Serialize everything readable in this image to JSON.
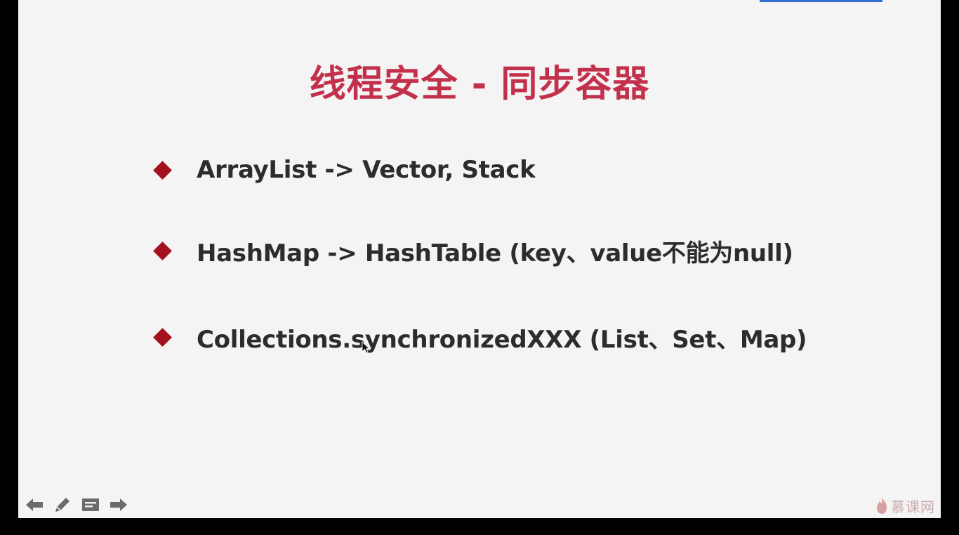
{
  "slide": {
    "title": "线程安全 - 同步容器",
    "bullets": [
      {
        "text": "ArrayList -> Vector, Stack"
      },
      {
        "text": "HashMap -> HashTable (key、value不能为null)"
      },
      {
        "text": "Collections.synchronizedXXX (List、Set、Map)"
      }
    ]
  },
  "controls": [
    {
      "icon": "arrow-left-icon"
    },
    {
      "icon": "pen-icon"
    },
    {
      "icon": "slide-menu-icon"
    },
    {
      "icon": "arrow-right-icon"
    }
  ],
  "logo": {
    "text": "慕课网",
    "icon": "flame-icon"
  },
  "colors": {
    "title": "#c3304b",
    "bullet": "#a3111d",
    "slide_background": "#f4f4f4",
    "frame": "#000000",
    "accent_strip": "#2f6fd6",
    "control_icons": "#6b6b6b",
    "logo": "#d9a0a0"
  }
}
